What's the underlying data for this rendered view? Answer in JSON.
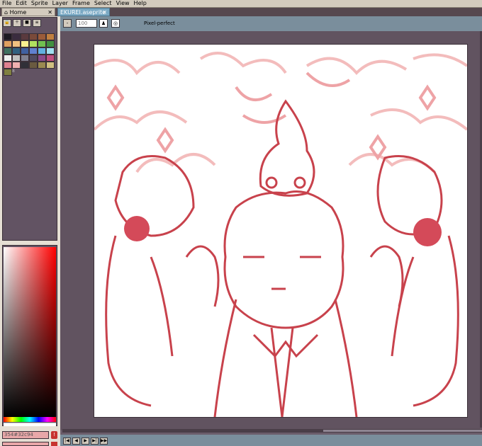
{
  "menu": [
    "File",
    "Edit",
    "Sprite",
    "Layer",
    "Frame",
    "Select",
    "View",
    "Help"
  ],
  "tabs": {
    "home": "Home",
    "file": "EKUREI.aseprite",
    "close": "✕"
  },
  "toolbar": {
    "zoom_value": "100",
    "pixel_perfect": "Pixel-perfect"
  },
  "palette": {
    "buttons": [
      "🔒",
      "＋",
      "■",
      "≡"
    ],
    "swatches": [
      "#1e1a22",
      "#3a2c3f",
      "#5a3a3e",
      "#7a4a3a",
      "#9b5c3a",
      "#c08040",
      "#e0a060",
      "#f0c080",
      "#f8f090",
      "#b0e060",
      "#70c050",
      "#409040",
      "#407060",
      "#306080",
      "#4060a0",
      "#6080d0",
      "#60b0e0",
      "#a0e0f0",
      "#f0f0f0",
      "#c0c0c0",
      "#808090",
      "#504a60",
      "#8a4a8a",
      "#c05080",
      "#e08090",
      "#f0b0b0",
      "#303038",
      "#6a5a40",
      "#9a8a50",
      "#d0c080",
      "#808040"
    ],
    "extra": "8"
  },
  "color": {
    "hex_value": "354#32c94",
    "warning": "!"
  },
  "status": {
    "nav": [
      "|◀",
      "◀",
      "▶",
      "▶|",
      "▶▶"
    ]
  },
  "icons": {
    "brush": "brush-icon",
    "onion": "onion-skin-icon"
  }
}
